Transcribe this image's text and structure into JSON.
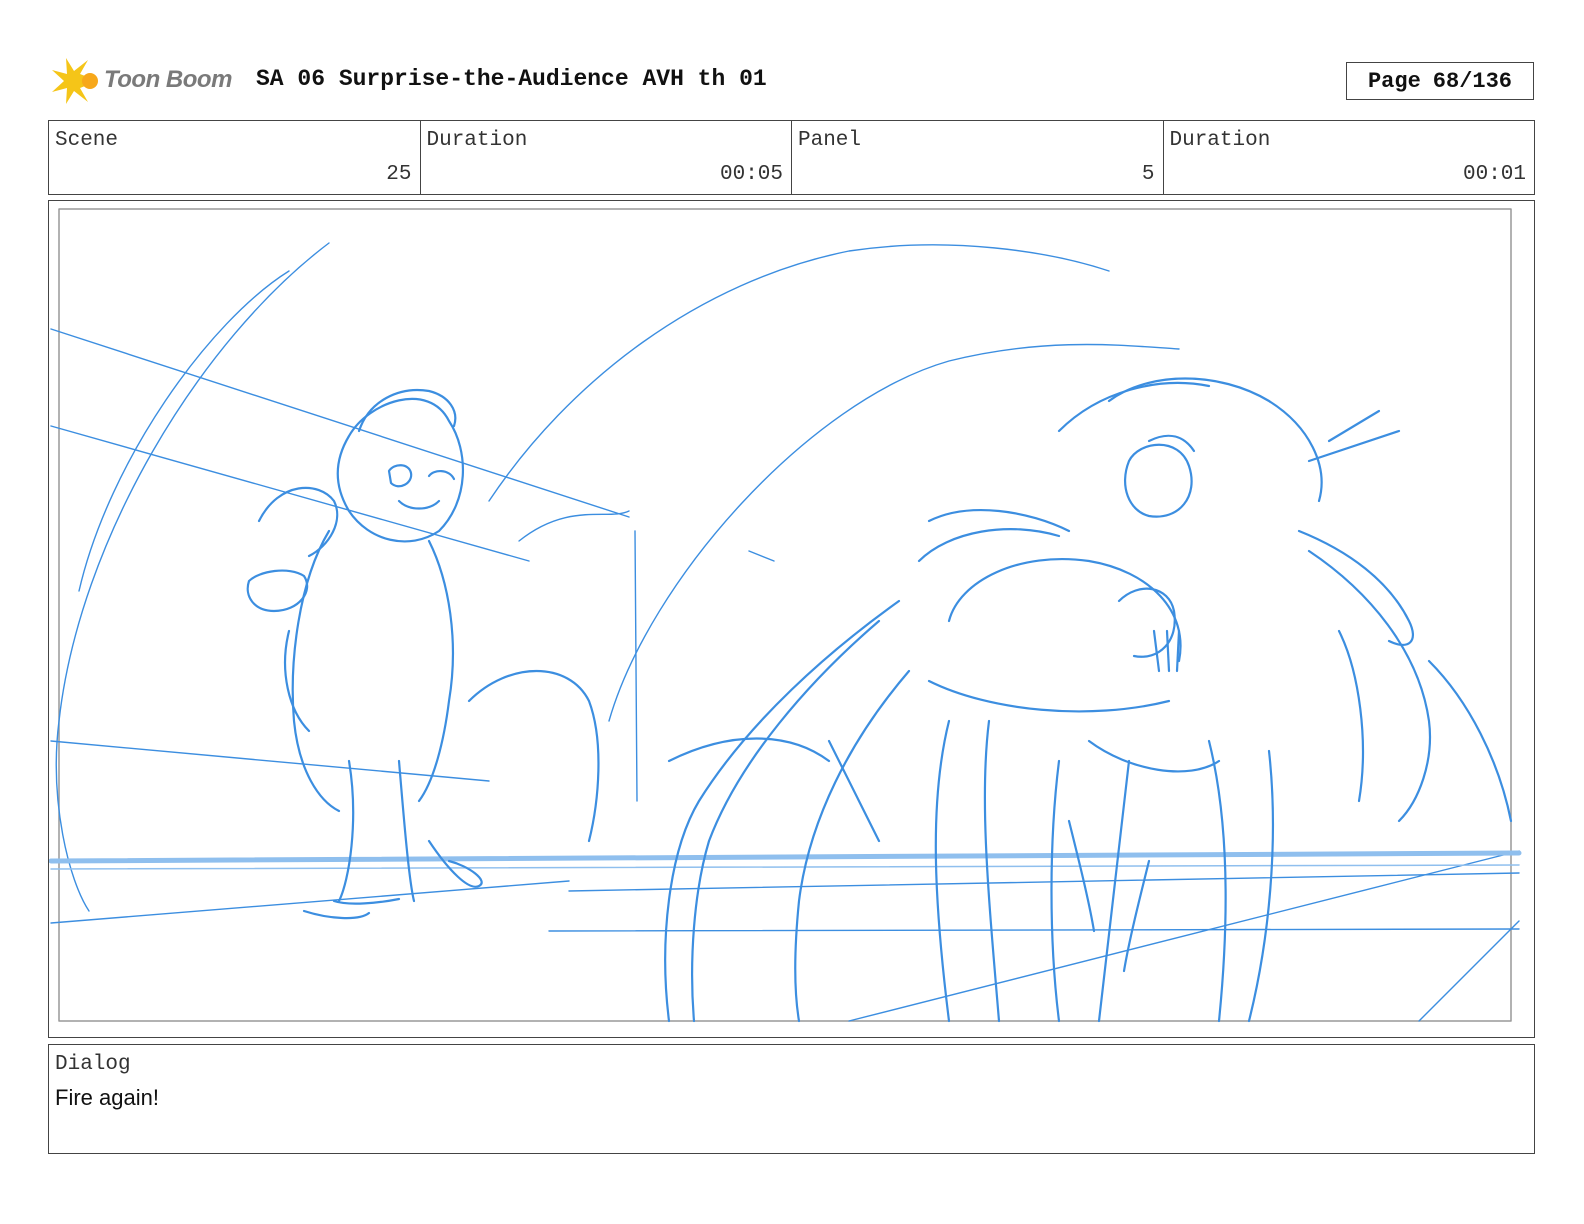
{
  "header": {
    "logo_text": "Toon Boom",
    "title": "SA 06 Surprise-the-Audience AVH th 01",
    "page_label": "Page",
    "page_value": "68/136"
  },
  "info": {
    "scene_label": "Scene",
    "scene_value": "25",
    "scene_duration_label": "Duration",
    "scene_duration_value": "00:05",
    "panel_label": "Panel",
    "panel_value": "5",
    "panel_duration_label": "Duration",
    "panel_duration_value": "00:01"
  },
  "dialog": {
    "label": "Dialog",
    "text": "Fire again!"
  },
  "colors": {
    "sketch": "#3c8ee0",
    "sketch_light": "#8fbfee",
    "logo_yellow": "#f5c518"
  }
}
